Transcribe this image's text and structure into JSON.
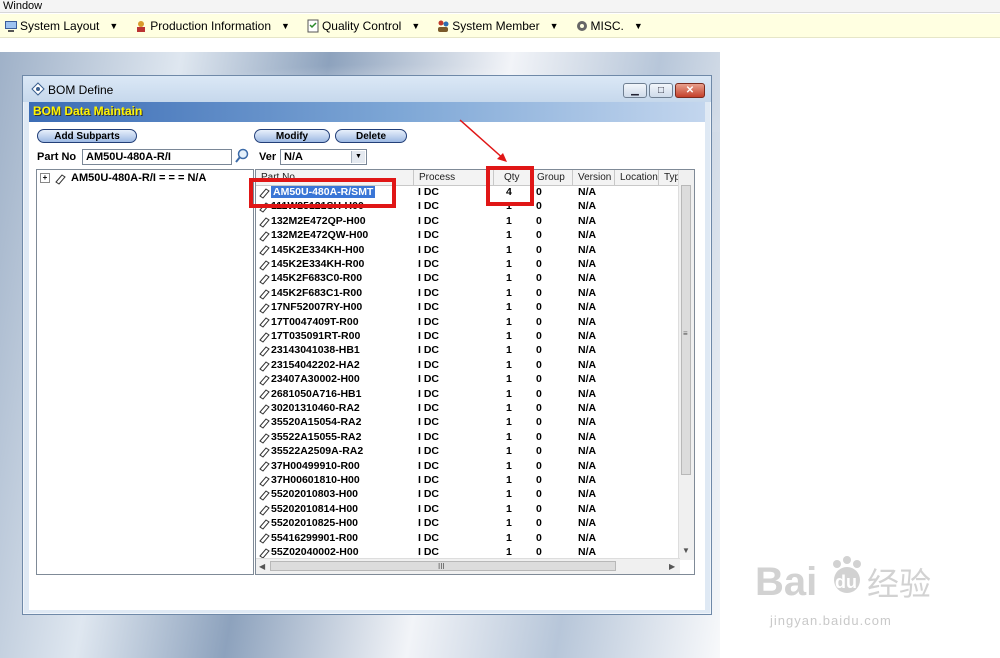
{
  "window_caption": "Window",
  "menu": [
    {
      "label": "System Layout",
      "icon": "computer-icon"
    },
    {
      "label": "Production Information",
      "icon": "factory-icon"
    },
    {
      "label": "Quality Control",
      "icon": "checklist-icon"
    },
    {
      "label": "System Member",
      "icon": "users-icon"
    },
    {
      "label": "MISC.",
      "icon": "gear-icon"
    }
  ],
  "dialog": {
    "title": "BOM Define",
    "section_title": "BOM Data Maintain",
    "buttons": {
      "add_subparts": "Add Subparts",
      "modify": "Modify",
      "delete": "Delete"
    },
    "part_no_label": "Part No",
    "part_no_value": "AM50U-480A-R/I",
    "ver_label": "Ver",
    "ver_value": "N/A",
    "tree_root": "AM50U-480A-R/I = = = N/A",
    "columns": [
      "Part No",
      "Process",
      "Qty",
      "Group",
      "Version",
      "Location",
      "Type"
    ],
    "rows": [
      {
        "part": "AM50U-480A-R/SMT",
        "process": "I DC",
        "qty": "4",
        "group": "0",
        "version": "N/A"
      },
      {
        "part": "111W25121SH-H00",
        "process": "I DC",
        "qty": "1",
        "group": "0",
        "version": "N/A"
      },
      {
        "part": "132M2E472QP-H00",
        "process": "I DC",
        "qty": "1",
        "group": "0",
        "version": "N/A"
      },
      {
        "part": "132M2E472QW-H00",
        "process": "I DC",
        "qty": "1",
        "group": "0",
        "version": "N/A"
      },
      {
        "part": "145K2E334KH-H00",
        "process": "I DC",
        "qty": "1",
        "group": "0",
        "version": "N/A"
      },
      {
        "part": "145K2E334KH-R00",
        "process": "I DC",
        "qty": "1",
        "group": "0",
        "version": "N/A"
      },
      {
        "part": "145K2F683C0-R00",
        "process": "I DC",
        "qty": "1",
        "group": "0",
        "version": "N/A"
      },
      {
        "part": "145K2F683C1-R00",
        "process": "I DC",
        "qty": "1",
        "group": "0",
        "version": "N/A"
      },
      {
        "part": "17NF52007RY-H00",
        "process": "I DC",
        "qty": "1",
        "group": "0",
        "version": "N/A"
      },
      {
        "part": "17T0047409T-R00",
        "process": "I DC",
        "qty": "1",
        "group": "0",
        "version": "N/A"
      },
      {
        "part": "17T035091RT-R00",
        "process": "I DC",
        "qty": "1",
        "group": "0",
        "version": "N/A"
      },
      {
        "part": "23143041038-HB1",
        "process": "I DC",
        "qty": "1",
        "group": "0",
        "version": "N/A"
      },
      {
        "part": "23154042202-HA2",
        "process": "I DC",
        "qty": "1",
        "group": "0",
        "version": "N/A"
      },
      {
        "part": "23407A30002-H00",
        "process": "I DC",
        "qty": "1",
        "group": "0",
        "version": "N/A"
      },
      {
        "part": "2681050A716-HB1",
        "process": "I DC",
        "qty": "1",
        "group": "0",
        "version": "N/A"
      },
      {
        "part": "30201310460-RA2",
        "process": "I DC",
        "qty": "1",
        "group": "0",
        "version": "N/A"
      },
      {
        "part": "35520A15054-RA2",
        "process": "I DC",
        "qty": "1",
        "group": "0",
        "version": "N/A"
      },
      {
        "part": "35522A15055-RA2",
        "process": "I DC",
        "qty": "1",
        "group": "0",
        "version": "N/A"
      },
      {
        "part": "35522A2509A-RA2",
        "process": "I DC",
        "qty": "1",
        "group": "0",
        "version": "N/A"
      },
      {
        "part": "37H00499910-R00",
        "process": "I DC",
        "qty": "1",
        "group": "0",
        "version": "N/A"
      },
      {
        "part": "37H00601810-H00",
        "process": "I DC",
        "qty": "1",
        "group": "0",
        "version": "N/A"
      },
      {
        "part": "55202010803-H00",
        "process": "I DC",
        "qty": "1",
        "group": "0",
        "version": "N/A"
      },
      {
        "part": "55202010814-H00",
        "process": "I DC",
        "qty": "1",
        "group": "0",
        "version": "N/A"
      },
      {
        "part": "55202010825-H00",
        "process": "I DC",
        "qty": "1",
        "group": "0",
        "version": "N/A"
      },
      {
        "part": "55416299901-R00",
        "process": "I DC",
        "qty": "1",
        "group": "0",
        "version": "N/A"
      },
      {
        "part": "55Z02040002-H00",
        "process": "I DC",
        "qty": "1",
        "group": "0",
        "version": "N/A"
      }
    ],
    "scroll_grip": "≡",
    "hscroll_grip": "III"
  },
  "watermark": {
    "logo": "Bai du 经验",
    "url": "jingyan.baidu.com"
  },
  "colors": {
    "highlight": "#e01616",
    "selection": "#3a76d6",
    "header_text": "#fff400"
  }
}
